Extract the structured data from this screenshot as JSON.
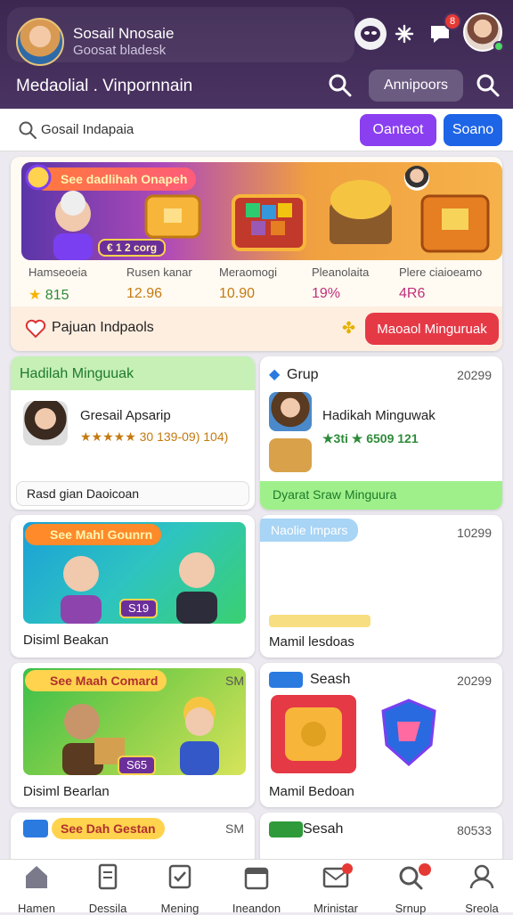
{
  "header": {
    "profile_name": "Sosail Nnosaie",
    "profile_sub": "Goosat bladesk",
    "title": "Medaolial . Vinpornnain",
    "action_label": "Annipoors",
    "notif_badge_count": "8"
  },
  "search": {
    "placeholder": "Gosail Indapaia",
    "btn1": "Oanteot",
    "btn2": "Soano"
  },
  "hero": {
    "tag": "See dadlihah Onapeh",
    "reward_label": "€ 1 2 corg",
    "stats": [
      {
        "label": "Hamseoeia",
        "value": "815"
      },
      {
        "label": "Rusen kanar",
        "value": "12.96"
      },
      {
        "label": "Meraomogi",
        "value": "10.90"
      },
      {
        "label": "Pleanolaita",
        "value": "19%"
      },
      {
        "label": "Plere ciaioeamo",
        "value": "4R6"
      }
    ],
    "footer_label": "Pajuan Indpaols",
    "footer_button": "Maoaol Minguruak"
  },
  "cards": {
    "c1": {
      "title": "Hadilah Minguuak",
      "name": "Gresail Apsarip",
      "rating": "★★★★★ 30 139-09) 104)",
      "foot": "Rasd gian Daoicoan"
    },
    "c2": {
      "title": "Grup",
      "num": "20299",
      "name": "Hadikah Minguwak",
      "rating": "★3ti ★ 6509 121",
      "foot": "Dyarat Sraw Minguura"
    },
    "c3": {
      "tag": "See Mahl Gounrn",
      "price": "S19",
      "foot": "Disiml Beakan"
    },
    "c4": {
      "tag": "Naolie Impars",
      "num": "10299",
      "foot": "Mamil lesdoas"
    },
    "c5": {
      "tag": "See Maah Comard",
      "num": "SM",
      "price": "S65",
      "foot": "Disiml Bearlan"
    },
    "c6": {
      "tag": "Seash",
      "num": "20299",
      "foot": "Mamil Bedoan"
    },
    "c7": {
      "tag": "See Dah Gestan",
      "num": "SM"
    },
    "c8": {
      "tag": "Sesah",
      "num": "80533"
    }
  },
  "nav": [
    {
      "label": "Hamen",
      "icon": "home-icon"
    },
    {
      "label": "Dessila",
      "icon": "document-icon"
    },
    {
      "label": "Mening",
      "icon": "checklist-icon"
    },
    {
      "label": "Ineandon",
      "icon": "calendar-icon"
    },
    {
      "label": "Mrinistar",
      "icon": "mail-icon"
    },
    {
      "label": "Srnup",
      "icon": "search-icon"
    },
    {
      "label": "Sreola",
      "icon": "user-icon"
    }
  ],
  "colors": {
    "accent": "#7a3ff0",
    "blue": "#1e64e6",
    "red": "#e53946",
    "green": "#7ce06a"
  }
}
